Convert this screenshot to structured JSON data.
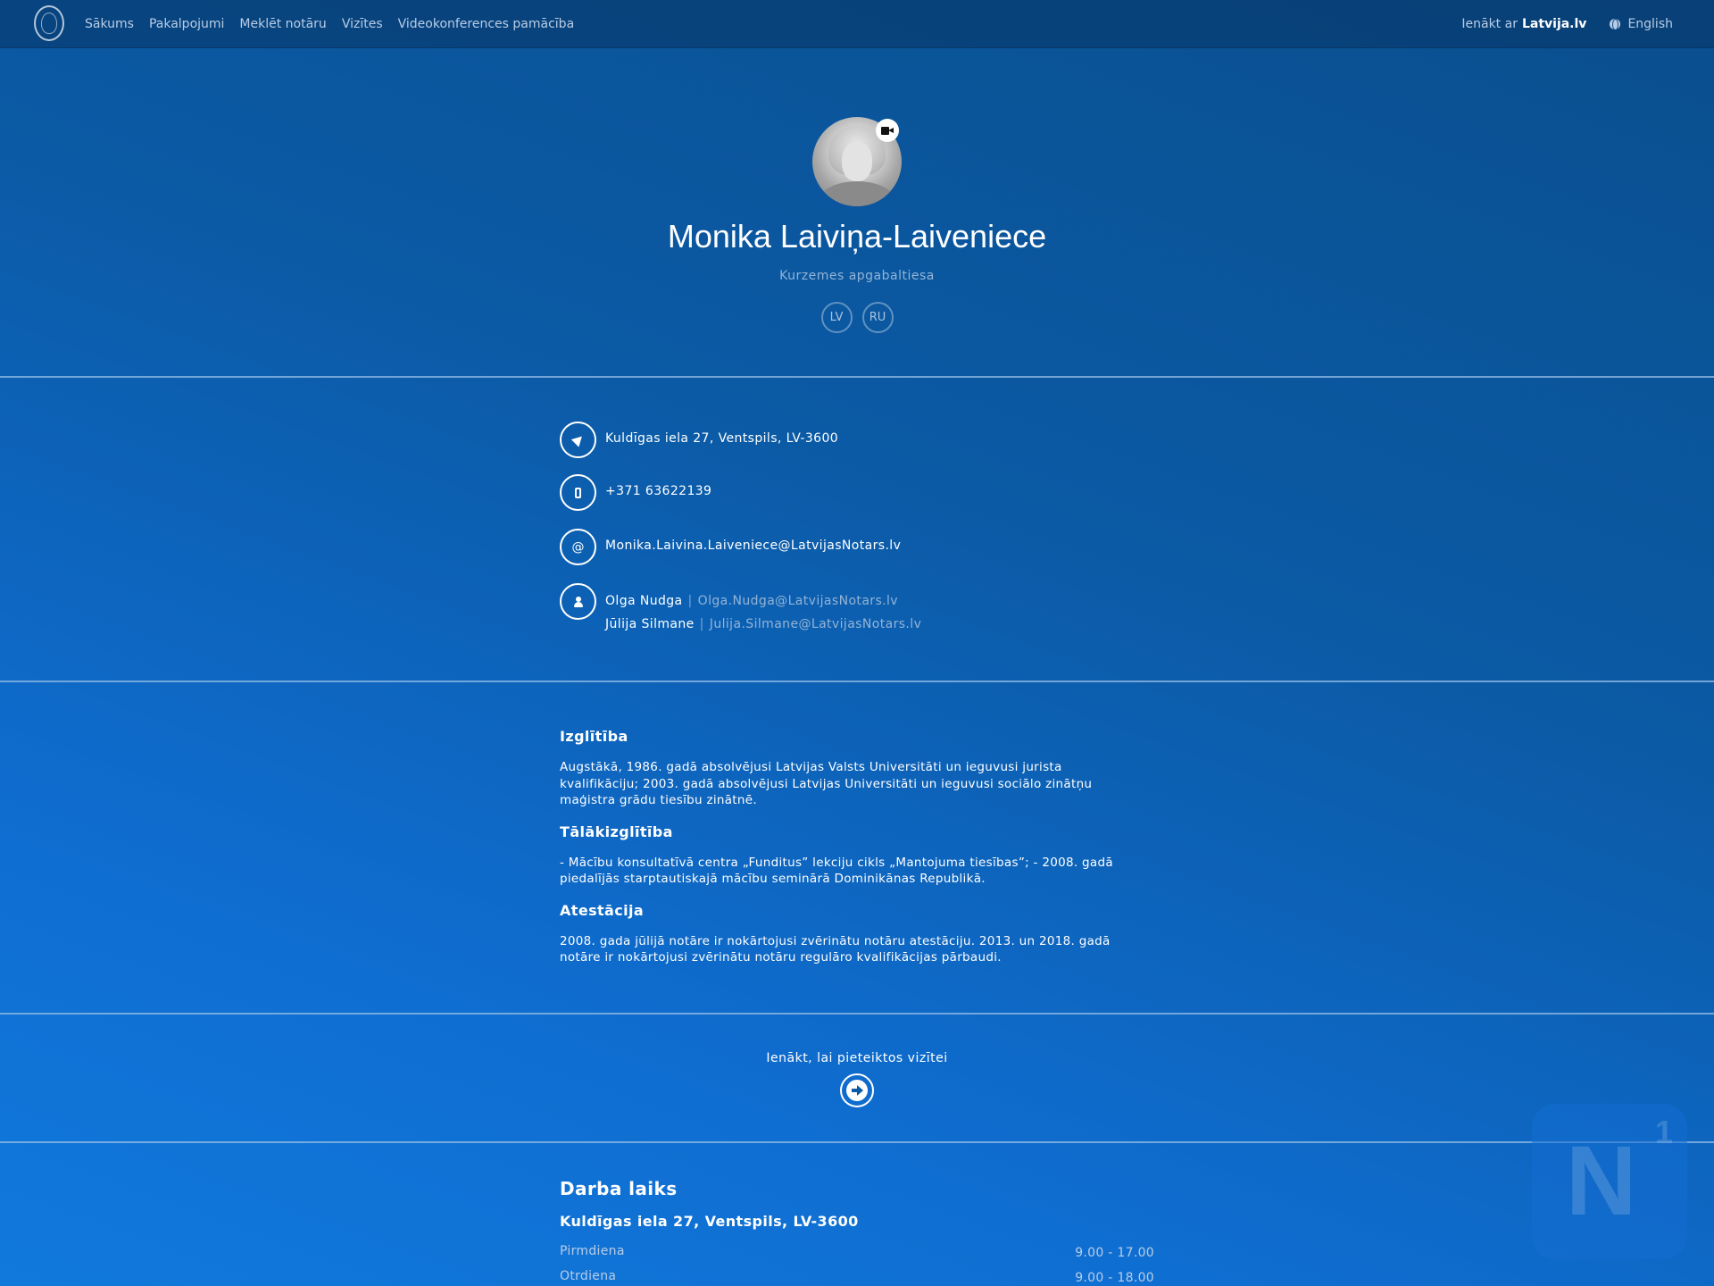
{
  "nav": {
    "logo_icon": "emblem-icon",
    "links": [
      "Sākums",
      "Pakalpojumi",
      "Meklēt notāru",
      "Vizītes",
      "Videokonferences pamācība"
    ],
    "login_prefix": "Ienākt ar",
    "login_brand": "Latvija.lv",
    "language": "English"
  },
  "profile": {
    "name": "Monika Laiviņa-Laiveniece",
    "court": "Kurzemes apgabaltiesa",
    "languages": [
      "LV",
      "RU"
    ],
    "video_badge_icon": "video-camera-icon"
  },
  "contact": {
    "address": "Kuldīgas iela 27, Ventspils, LV-3600",
    "phone": "+371 63622139",
    "email_symbol": "@",
    "email": "Monika.Laivina.Laiveniece@LatvijasNotars.lv",
    "assistants": [
      {
        "name": "Olga Nudga",
        "separator": "|",
        "email": "Olga.Nudga@LatvijasNotars.lv"
      },
      {
        "name": "Jūlija Silmane",
        "separator": "|",
        "email": "Julija.Silmane@LatvijasNotars.lv"
      }
    ]
  },
  "about": {
    "education_title": "Izglītība",
    "education_text": "Augstākā, 1986. gadā absolvējusi Latvijas Valsts Universitāti un ieguvusi jurista kvalifikāciju; 2003. gadā absolvējusi Latvijas Universitāti un ieguvusi sociālo zinātņu maģistra grādu tiesību zinātnē.",
    "further_title": "Tālākizglītība",
    "further_text": "- Mācību konsultatīvā centra „Funditus” lekciju cikls „Mantojuma tiesības”; - 2008. gadā piedalījās starptautiskajā mācību seminārā Dominikānas Republikā.",
    "attestation_title": "Atestācija",
    "attestation_text": "2008. gada jūlijā notāre ir nokārtojusi zvērinātu notāru atestāciju. 2013. un 2018. gadā notāre ir nokārtojusi zvērinātu notāru regulāro kvalifikācijas pārbaudi."
  },
  "cta": {
    "text": "Ienākt, lai pieteiktos vizītei",
    "icon": "arrow-right-icon"
  },
  "hours": {
    "title": "Darba laiks",
    "address": "Kuldīgas iela 27, Ventspils, LV-3600",
    "rows": [
      {
        "day": "Pirmdiena",
        "time": "9.00 - 17.00"
      },
      {
        "day": "Otrdiena",
        "time": "9.00 - 18.00"
      }
    ]
  },
  "watermark": {
    "letter": "N",
    "number": "1"
  },
  "colors": {
    "background_top": "#0a4f8e",
    "background_bottom": "#1179dc",
    "muted_text": "#b9cde6",
    "link_muted": "#93b4d6"
  }
}
